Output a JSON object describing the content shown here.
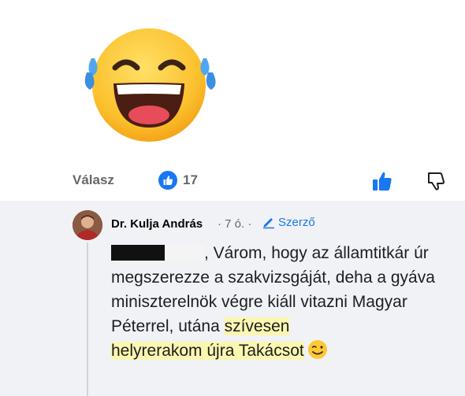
{
  "post": {
    "emoji": "tears-of-joy-emoji",
    "actions": {
      "reply_label": "Válasz",
      "like_count": "17",
      "like_icon": "like-badge-icon",
      "thumb_up_icon": "thumb-up-icon",
      "thumb_down_icon": "thumb-down-icon"
    }
  },
  "reply": {
    "author": "Dr. Kulja András",
    "time": "· 7 ó. ·",
    "badge_label": "Szerző",
    "text_part1": "Várom, hogy az államtitkár úr megszerezze a szakvizsgáját, deha a gyáva miniszterelnök végre kiáll vitazni Magyar Péterrel, utána ",
    "text_highlight1": "szívesen",
    "text_highlight2": "helyrerakom újra Takácsot",
    "emoji_end": "winking-smile-emoji"
  },
  "colors": {
    "accent": "#1877f2",
    "highlight": "#fbf7b0",
    "reply_bg": "#f0f2f5",
    "muted": "#65676b"
  }
}
